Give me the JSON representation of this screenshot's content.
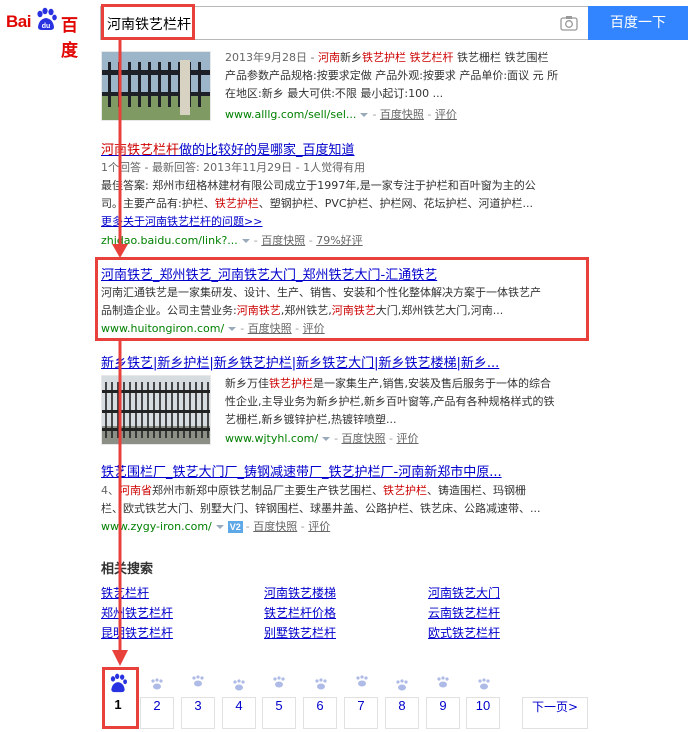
{
  "header": {
    "logo_text_left": "Bai",
    "logo_paw_text": "du",
    "logo_text_right": "百度",
    "query": "河南铁艺栏杆",
    "search_button": "百度一下",
    "camera_icon": "camera-icon"
  },
  "results": [
    {
      "abstract_lines": [
        [
          "2013年9月28日 - ",
          "河南",
          "新乡",
          "铁艺护栏",
          " ",
          "铁艺栏杆",
          " 铁艺栅栏 铁艺围栏"
        ],
        [
          "产品参数产品规格:按要求定做 产品外观:按要求 产品单价:面议 元 所"
        ],
        [
          "在地区:新乡 最大可供:不限 最小起订:100 ..."
        ]
      ],
      "url": "www.alllg.com/sell/sel...",
      "snapshot": "百度快照",
      "review": "评价"
    },
    {
      "title_parts": [
        "河南铁艺栏杆",
        "做的比较好的是哪家_百度知道"
      ],
      "meta": "1个回答 - 最新回答: 2013年11月29日 - 1人觉得有用",
      "line1": "最佳答案: 郑州市纽格林建材有限公司成立于1997年,是一家专注于护栏和百叶窗为主的公",
      "line2_parts": [
        "司。主要产品有:护栏、",
        "铁艺护栏",
        "、塑钢护栏、PVC护栏、护栏网、花坛护栏、河道护栏..."
      ],
      "more": "更多关于河南铁艺栏杆的问题>>",
      "url": "zhidao.baidu.com/link?...",
      "snapshot": "百度快照",
      "rating": "79%好评"
    },
    {
      "title": "河南铁艺_郑州铁艺_河南铁艺大门_郑州铁艺大门-汇通铁艺",
      "line1": "河南汇通铁艺是一家集研发、设计、生产、销售、安装和个性化整体解决方案于一体铁艺产",
      "line2_parts": [
        "品制造企业。公司主营业务:",
        "河南铁艺",
        ",郑州铁艺,",
        "河南铁艺",
        "大门,郑州铁艺大门,河南..."
      ],
      "url": "www.huitongiron.com/",
      "snapshot": "百度快照",
      "review": "评价"
    },
    {
      "title": "新乡铁艺|新乡护栏|新乡铁艺护栏|新乡铁艺大门|新乡铁艺楼梯|新乡...",
      "lines": [
        [
          "新乡万佳",
          "铁艺护栏",
          "是一家集生产,销售,安装及售后服务于一体的综合"
        ],
        [
          "性企业,主导业务为新乡护栏,新乡百叶窗等,产品有各种规格样式的铁"
        ],
        [
          "艺栅栏,新乡镀锌护栏,热镀锌喷塑..."
        ]
      ],
      "url": "www.wjtyhl.com/",
      "snapshot": "百度快照",
      "review": "评价"
    },
    {
      "title": "铁艺围栏厂_铁艺大门厂_铸钢减速带厂_铁艺护栏厂-河南新郑市中原...",
      "line1_parts": [
        "4、",
        "河南省",
        "郑州市新郑中原铁艺制品厂主要生产铁艺围栏、",
        "铁艺护栏",
        "、铸造围栏、玛钢栅"
      ],
      "line2": "栏、欧式铁艺大门、别墅大门、锌钢围栏、球墨井盖、公路护栏、铁艺床、公路减速带、...",
      "url": "www.zygy-iron.com/",
      "badge": "V2",
      "snapshot": "百度快照",
      "review": "评价"
    }
  ],
  "related": {
    "title": "相关搜索",
    "items": [
      [
        "铁艺栏杆",
        "河南铁艺楼梯",
        "河南铁艺大门"
      ],
      [
        "郑州铁艺栏杆",
        "铁艺栏杆价格",
        "云南铁艺栏杆"
      ],
      [
        "昆明铁艺栏杆",
        "别墅铁艺栏杆",
        "欧式铁艺栏杆"
      ]
    ]
  },
  "pagination": {
    "pages": [
      "1",
      "2",
      "3",
      "4",
      "5",
      "6",
      "7",
      "8",
      "9",
      "10"
    ],
    "current": "1",
    "next": "下一页>"
  },
  "colors": {
    "brand_red": "#e10602",
    "link_blue": "#0000cc",
    "highlight_red": "#cc0000",
    "url_green": "#008000",
    "button_blue": "#3385ff",
    "annotation_red": "#e8403a"
  }
}
